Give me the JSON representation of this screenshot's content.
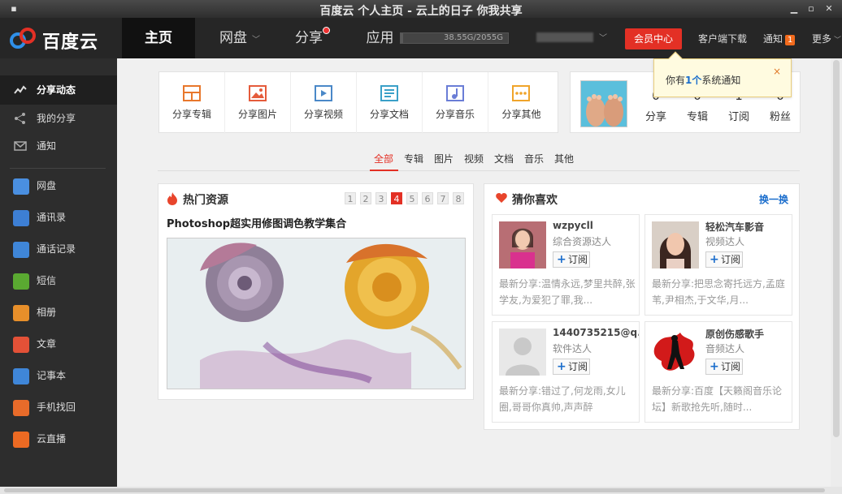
{
  "window": {
    "title": "百度云 个人主页 - 云上的日子 你我共享"
  },
  "logo": {
    "text": "百度云"
  },
  "topnav": {
    "tabs": [
      {
        "label": "主页"
      },
      {
        "label": "网盘"
      },
      {
        "label": "分享"
      },
      {
        "label": "应用"
      }
    ],
    "quota": "38.55G/2055G",
    "quota_fraction": 0.0188,
    "vip": "会员中心",
    "client_download": "客户端下载",
    "notify": "通知",
    "notify_count": "1",
    "more": "更多"
  },
  "sidebar": {
    "items": [
      {
        "label": "分享动态"
      },
      {
        "label": "我的分享"
      },
      {
        "label": "通知"
      }
    ],
    "apps": [
      {
        "label": "网盘",
        "color": "#4a8fe0"
      },
      {
        "label": "通讯录",
        "color": "#3d7fd4"
      },
      {
        "label": "通话记录",
        "color": "#3f86d8"
      },
      {
        "label": "短信",
        "color": "#5aa931"
      },
      {
        "label": "相册",
        "color": "#e78f2a"
      },
      {
        "label": "文章",
        "color": "#e35137"
      },
      {
        "label": "记事本",
        "color": "#3f86d8"
      },
      {
        "label": "手机找回",
        "color": "#e86b2a"
      },
      {
        "label": "云直播",
        "color": "#ec6a23"
      }
    ]
  },
  "share_types": [
    {
      "label": "分享专辑",
      "color": "#e8772b"
    },
    {
      "label": "分享图片",
      "color": "#e55b3b"
    },
    {
      "label": "分享视频",
      "color": "#4a88c8"
    },
    {
      "label": "分享文档",
      "color": "#3aa0c8"
    },
    {
      "label": "分享音乐",
      "color": "#6a7dd6"
    },
    {
      "label": "分享其他",
      "color": "#f0a42a"
    }
  ],
  "profile": {
    "stats": [
      {
        "label": "分享",
        "value": "0"
      },
      {
        "label": "专辑",
        "value": "0"
      },
      {
        "label": "订阅",
        "value": "1"
      },
      {
        "label": "粉丝",
        "value": "0"
      }
    ]
  },
  "notice": {
    "prefix": "你有",
    "count": "1个",
    "suffix": "系统通知",
    "close": "×"
  },
  "filters": [
    "全部",
    "专辑",
    "图片",
    "视频",
    "文档",
    "音乐",
    "其他"
  ],
  "hot": {
    "title": "热门资源",
    "pages": [
      "1",
      "2",
      "3",
      "4",
      "5",
      "6",
      "7",
      "8"
    ],
    "active_page": "4",
    "subtitle": "Photoshop超实用修图调色教学集合"
  },
  "likes": {
    "title": "猜你喜欢",
    "change": "换一换",
    "subscribe": "订阅",
    "people": [
      {
        "name": "wzpycll",
        "role": "综合资源达人",
        "recent": "最新分享:温情永远,梦里共醉,张学友,为爱犯了罪,我..."
      },
      {
        "name": "轻松汽车影音",
        "role": "视频达人",
        "recent": "最新分享:把思念寄托远方,孟庭苇,尹相杰,于文华,月..."
      },
      {
        "name": "1440735215@q...",
        "role": "软件达人",
        "recent": "最新分享:错过了,何龙雨,女儿圈,哥哥你真帅,声声醉"
      },
      {
        "name": "原创伤感歌手",
        "role": "音频达人",
        "recent": "最新分享:百度【天籁阁音乐论坛】新歌抢先听,随时..."
      }
    ]
  }
}
